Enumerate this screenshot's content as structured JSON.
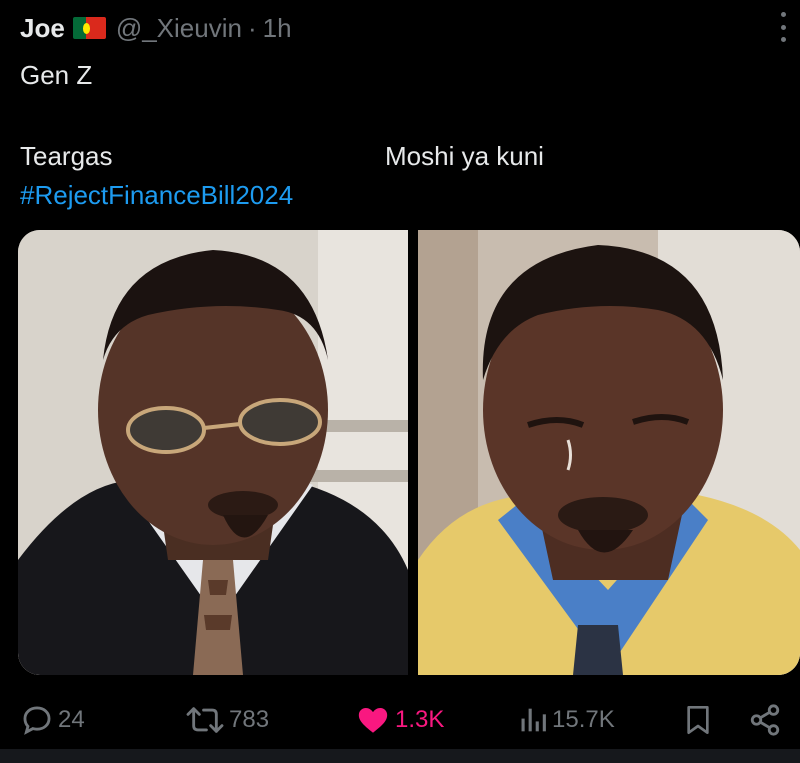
{
  "post": {
    "author": {
      "display_name": "Joe",
      "flag_icon": "portugal-flag-icon",
      "handle": "@_Xieuvin",
      "separator": "·",
      "time": "1h"
    },
    "text_line1": "Gen Z",
    "left_caption": "Teargas",
    "right_caption": "Moshi ya kuni",
    "hashtag": "#RejectFinanceBill2024",
    "media": [
      {
        "name": "man-with-sunglasses-image"
      },
      {
        "name": "man-crying-image"
      }
    ]
  },
  "actions": {
    "replies": {
      "icon": "reply-icon",
      "count": "24"
    },
    "reposts": {
      "icon": "repost-icon",
      "count": "783"
    },
    "likes": {
      "icon": "heart-icon",
      "count": "1.3K",
      "active": true
    },
    "views": {
      "icon": "views-icon",
      "count": "15.7K"
    },
    "bookmark": {
      "icon": "bookmark-icon"
    },
    "share": {
      "icon": "share-icon"
    }
  },
  "colors": {
    "background": "#000000",
    "text": "#e7e9ea",
    "secondary": "#71767b",
    "link": "#1d9bf0",
    "like": "#f91880"
  }
}
